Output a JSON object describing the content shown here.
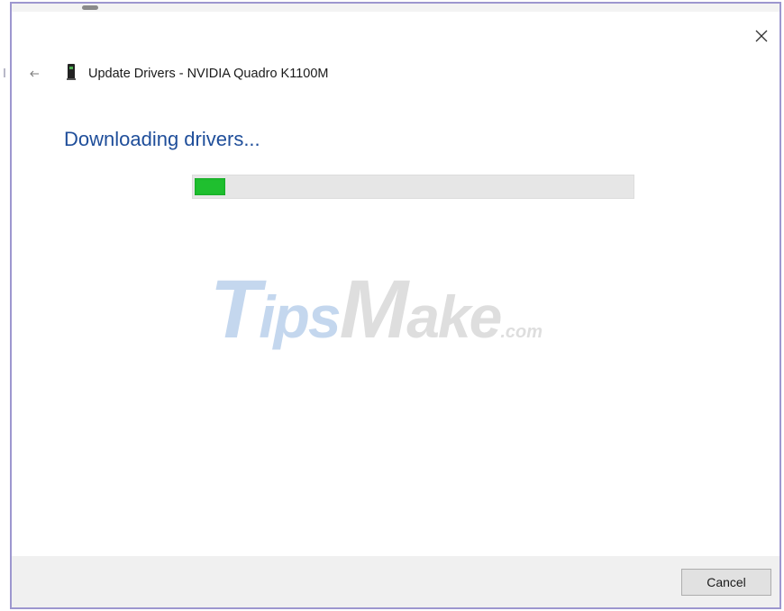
{
  "dialog": {
    "title": "Update Drivers - NVIDIA Quadro K1100M",
    "heading": "Downloading drivers...",
    "progress": 0.07
  },
  "watermark": {
    "part1": "T",
    "part2": "ips",
    "part3": "M",
    "part4": "ake",
    "part5": ".com"
  },
  "footer": {
    "cancel_label": "Cancel"
  },
  "colors": {
    "heading": "#1f4e9a",
    "progress_fill": "#1fbf2f",
    "window_border": "#9d97cf"
  },
  "icons": {
    "back": "back-arrow-icon",
    "close": "close-icon",
    "device": "graphics-card-icon"
  }
}
